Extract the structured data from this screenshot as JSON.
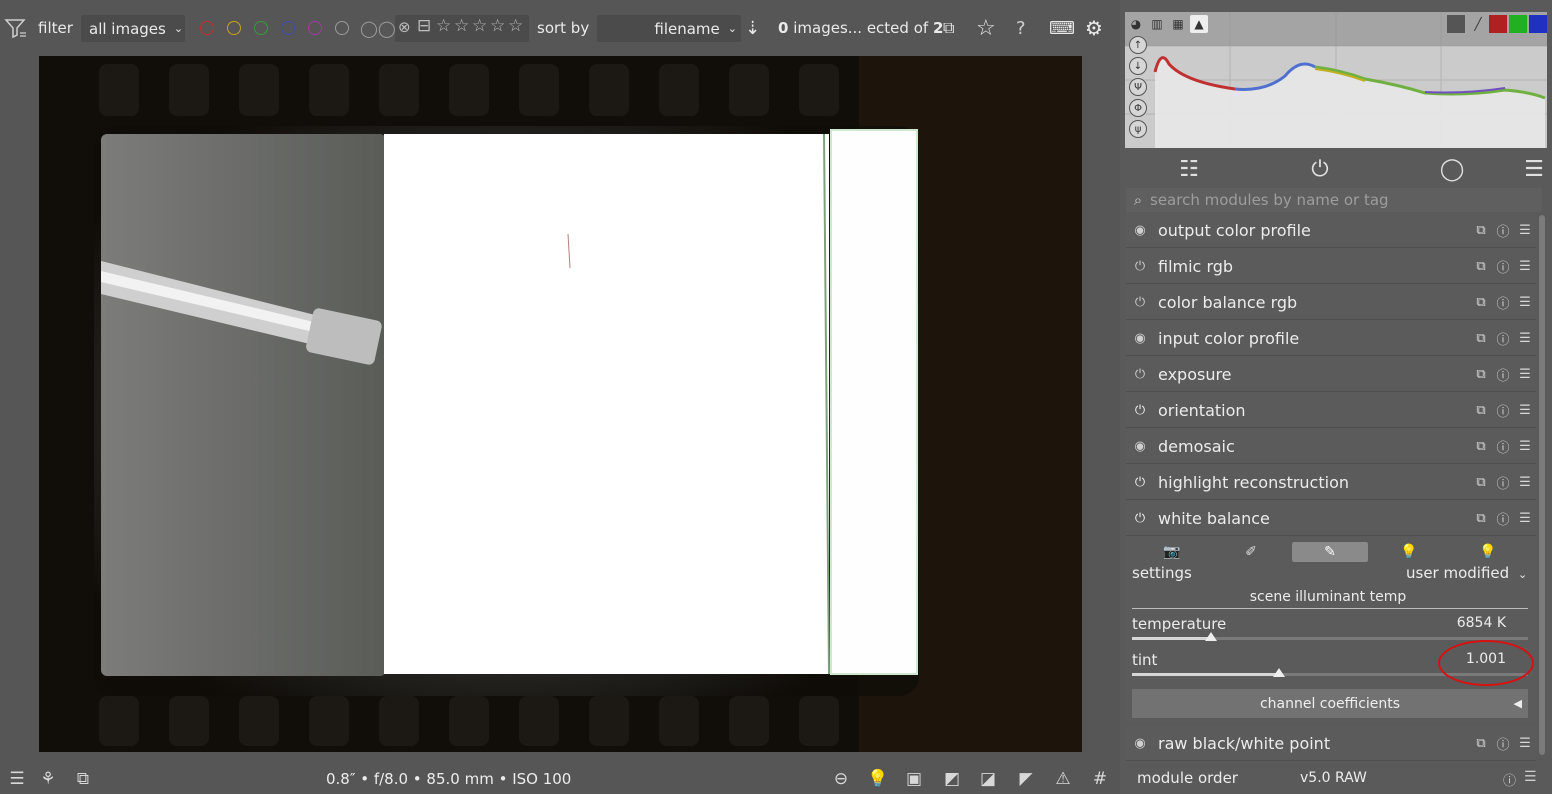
{
  "topbar": {
    "filter_label": "filter",
    "collection_value": "all images",
    "sort_label": "sort by",
    "sort_value": "filename",
    "selection_count": "0",
    "selection_text": "images... ected of",
    "selection_total": "2",
    "color_labels": [
      "#c03030",
      "#c8a020",
      "#3a9a3a",
      "#3a4fb0",
      "#a03aa0",
      "#9a9a9a"
    ]
  },
  "bottombar": {
    "exif": "0.8″ • f/8.0 • 85.0 mm • ISO 100"
  },
  "histogram": {
    "channel_colors": [
      "#b02020",
      "#20a020",
      "#2030c0"
    ]
  },
  "search": {
    "placeholder": "search modules by name or tag"
  },
  "modules": [
    {
      "label": "output color profile",
      "power": "◉"
    },
    {
      "label": "filmic rgb",
      "power": "⏻"
    },
    {
      "label": "color balance rgb",
      "power": "⏻"
    },
    {
      "label": "input color profile",
      "power": "◉"
    },
    {
      "label": "exposure",
      "power": "⏻"
    },
    {
      "label": "orientation",
      "power": "⏻"
    },
    {
      "label": "demosaic",
      "power": "◉"
    },
    {
      "label": "highlight reconstruction",
      "power": "⏻"
    },
    {
      "label": "white balance",
      "power": "⏻"
    }
  ],
  "white_balance": {
    "settings_label": "settings",
    "preset_value": "user modified",
    "section_label": "scene illuminant temp",
    "temperature_label": "temperature",
    "temperature_value": "6854 K",
    "temperature_level": 0.2,
    "tint_label": "tint",
    "tint_value": "1.001",
    "tint_level": 0.37,
    "coeff_label": "channel coefficients"
  },
  "raw_module": {
    "label": "raw black/white point"
  },
  "footer": {
    "module_order_label": "module order",
    "module_order_value": "v5.0 RAW"
  }
}
